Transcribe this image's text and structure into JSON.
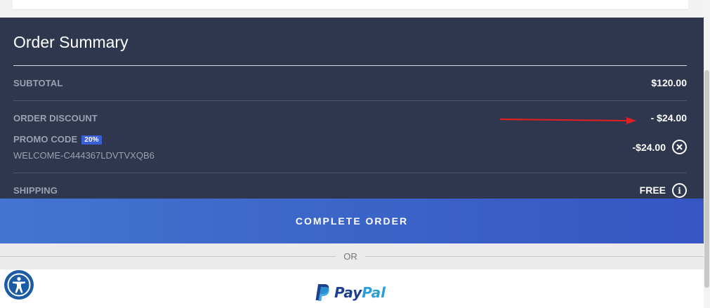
{
  "order_summary": {
    "title": "Order Summary",
    "subtotal": {
      "label": "SUBTOTAL",
      "value": "$120.00"
    },
    "order_discount": {
      "label": "ORDER DISCOUNT",
      "value": "- $24.00"
    },
    "promo": {
      "label": "PROMO CODE",
      "badge": "20%",
      "code": "WELCOME-C444367LDVTVXQB6",
      "value": "-$24.00",
      "remove_icon": "close-circle-icon"
    },
    "shipping": {
      "label": "SHIPPING",
      "value": "FREE",
      "info_icon": "info-circle-icon"
    }
  },
  "actions": {
    "complete_order_label": "COMPLETE ORDER",
    "separator_label": "OR"
  },
  "paypal": {
    "word_pay": "Pay",
    "word_pal": "Pal"
  },
  "colors": {
    "summary_bg": "#2e374d",
    "button_blue": "#3c66c9",
    "badge_blue": "#3b5fd6",
    "annotation_arrow": "#e02020"
  }
}
